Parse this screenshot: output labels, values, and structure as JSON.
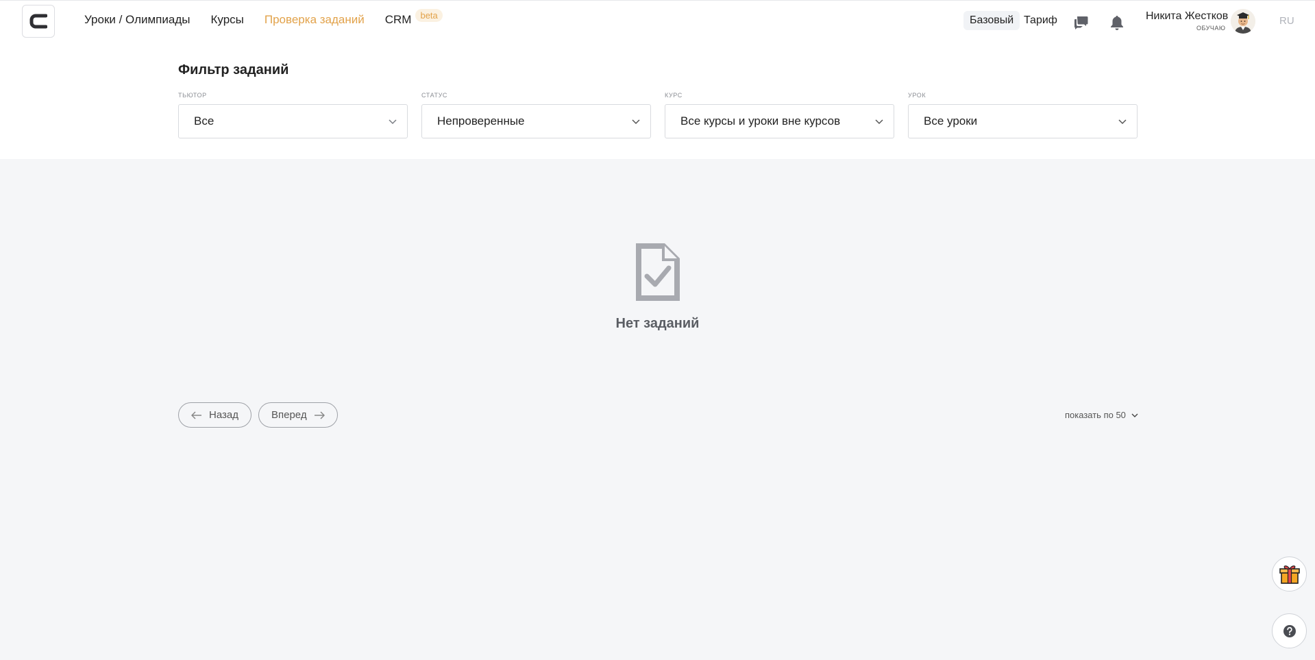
{
  "nav": {
    "items": [
      {
        "label": "Уроки / Олимпиады",
        "active": false
      },
      {
        "label": "Курсы",
        "active": false
      },
      {
        "label": "Проверка заданий",
        "active": true
      },
      {
        "label": "CRM",
        "active": false
      }
    ],
    "crm_badge": "beta"
  },
  "account": {
    "plan": "Базовый",
    "tariff": "Тариф",
    "user_name": "Никита Жестков",
    "user_role": "ОБУЧАЮ",
    "language": "RU"
  },
  "filter": {
    "title": "Фильтр заданий",
    "tutor": {
      "label": "ТЬЮТОР",
      "value": "Все"
    },
    "status": {
      "label": "СТАТУС",
      "value": "Непроверенные"
    },
    "course": {
      "label": "КУРС",
      "value": "Все курсы и уроки вне курсов"
    },
    "lesson": {
      "label": "УРОК",
      "value": "Все уроки"
    }
  },
  "empty_state": {
    "text": "Нет заданий",
    "icon": "document-check-icon"
  },
  "pagination": {
    "prev_label": "Назад",
    "next_label": "Вперед",
    "per_page_label": "показать по 50"
  },
  "colors": {
    "accent": "#e2a24a",
    "background": "#f5f6f8",
    "icon_gray": "#a8aab0"
  }
}
